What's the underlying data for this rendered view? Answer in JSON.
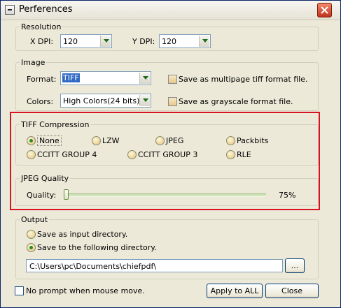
{
  "window": {
    "title": "Perferences"
  },
  "resolution": {
    "legend": "Resolution",
    "xdpi_label": "X DPI:",
    "xdpi_value": "120",
    "ydpi_label": "Y DPI:",
    "ydpi_value": "120"
  },
  "image": {
    "legend": "Image",
    "format_label": "Format:",
    "format_value": "TIFF",
    "colors_label": "Colors:",
    "colors_value": "High Colors(24 bits)",
    "multipage_label": "Save as multipage tiff format file.",
    "grayscale_label": "Save as grayscale format file."
  },
  "tiff_compression": {
    "legend": "TIFF Compression",
    "options": [
      "None",
      "LZW",
      "JPEG",
      "Packbits",
      "CCITT GROUP 4",
      "CCITT GROUP 3",
      "RLE"
    ],
    "selected": "None"
  },
  "jpeg_quality": {
    "legend": "JPEG Quality",
    "quality_label": "Quality:",
    "quality_value": "75%",
    "slider_level": 0
  },
  "output": {
    "legend": "Output",
    "option_input_dir": "Save as input directory.",
    "option_following_dir": "Save to the following directory.",
    "selected": "following",
    "directory": "C:\\Users\\pc\\Documents\\chiefpdf\\",
    "browse_label": "..."
  },
  "footer": {
    "no_prompt_label": "No prompt when mouse move.",
    "apply_all_label": "Apply to ALL",
    "close_label": "Close"
  },
  "colors": {
    "highlight": "#d8131f",
    "title_bg": "#f3f2ec",
    "dialog_bg": "#ece9d8"
  }
}
